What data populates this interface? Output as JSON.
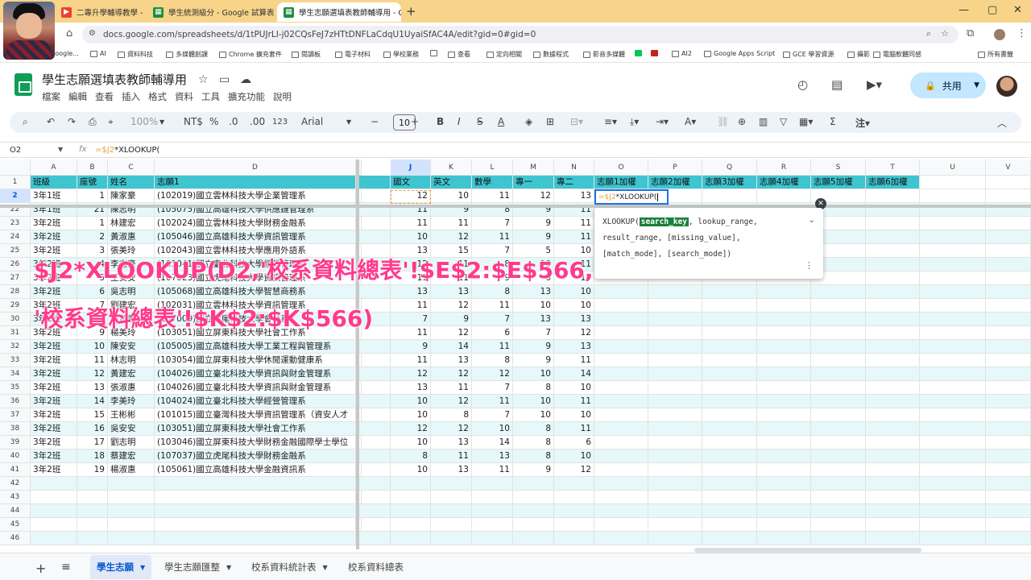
{
  "browser": {
    "tabs": [
      {
        "title": "二專升學輔導教學 - Goo",
        "icon": "youtube-icon"
      },
      {
        "title": "學生統測級分 - Google 試算表",
        "icon": "sheets-icon"
      },
      {
        "title": "學生志願選填表教師輔導用 - G",
        "icon": "sheets-icon",
        "active": true
      }
    ],
    "url": "docs.google.com/spreadsheets/d/1tPUJrLI-j02CQsFeJ7zHTtDNFLaCdqU1UyaiSfAC4A/edit?gid=0#gid=0",
    "bookmarks": [
      "Google...",
      "AI",
      "資料科技",
      "多媒體創課",
      "Chrome 擴充套件",
      "閱讀板",
      "電子材料",
      "學校業務",
      "",
      "查看",
      "定向相關",
      "數據程式",
      "影音多媒體",
      "",
      "",
      "AI2",
      "Google Apps Script",
      "GCE 學習資源",
      "攝影",
      "電腦軟體同感"
    ],
    "all_bookmarks": "所有書籤"
  },
  "doc": {
    "title": "學生志願選填表教師輔導用",
    "menu": [
      "檔案",
      "編輯",
      "查看",
      "插入",
      "格式",
      "資料",
      "工具",
      "擴充功能",
      "說明"
    ],
    "share_label": "共用"
  },
  "toolbar": {
    "zoom": "100%",
    "currency": "NT$",
    "percent": "%",
    "dec_less": ".0",
    "dec_more": ".00",
    "num_format": "123",
    "font": "Arial",
    "font_size": "10"
  },
  "formula_bar": {
    "name_box": "O2",
    "fx": "fx",
    "formula_ref": "=$J2",
    "formula_rest": "*XLOOKUP("
  },
  "grid": {
    "column_letters": [
      "A",
      "B",
      "C",
      "D",
      "J",
      "K",
      "L",
      "M",
      "N",
      "O",
      "P",
      "Q",
      "R",
      "S",
      "T",
      "U",
      "V"
    ],
    "headers": [
      "班級",
      "座號",
      "姓名",
      "志願1",
      "國文",
      "英文",
      "數學",
      "專一",
      "專二",
      "志願1加權",
      "志願2加權",
      "志願3加權",
      "志願4加權",
      "志願5加權",
      "志願6加權"
    ],
    "rows": [
      {
        "n": "2",
        "cls": "3年1班",
        "seat": "1",
        "name": "陳家豪",
        "choice": "(102019)國立雲林科技大學企業管理系",
        "scores": [
          "12",
          "10",
          "11",
          "12",
          "13"
        ]
      },
      {
        "n": "22",
        "cls": "3年1班",
        "seat": "21",
        "name": "陳志明",
        "choice": "(105075)國立高雄科技大學供應鏈管理系",
        "scores": [
          "11",
          "9",
          "8",
          "9",
          "11"
        ]
      },
      {
        "n": "23",
        "cls": "3年2班",
        "seat": "1",
        "name": "林建宏",
        "choice": "(102024)國立雲林科技大學財務金融系",
        "scores": [
          "11",
          "11",
          "7",
          "9",
          "11"
        ]
      },
      {
        "n": "24",
        "cls": "3年2班",
        "seat": "2",
        "name": "黃淑惠",
        "choice": "(105046)國立高雄科技大學資訊管理系",
        "scores": [
          "10",
          "12",
          "11",
          "9",
          "11"
        ]
      },
      {
        "n": "25",
        "cls": "3年2班",
        "seat": "3",
        "name": "張美玲",
        "choice": "(102043)國立雲林科技大學應用外語系",
        "scores": [
          "13",
          "15",
          "7",
          "5",
          "10"
        ]
      },
      {
        "n": "26",
        "cls": "3年2班",
        "seat": "4",
        "name": "李志豪",
        "choice": "(101041)國立臺北科技大學經營管理系",
        "scores": [
          "12",
          "11",
          "8",
          "10",
          "11"
        ]
      },
      {
        "n": "27",
        "cls": "3年2班",
        "seat": "5",
        "name": "王安安",
        "choice": "(107023)國立虎尾科技大學資訊管理系",
        "scores": [
          "11",
          "11",
          "9",
          "6",
          "13"
        ]
      },
      {
        "n": "28",
        "cls": "3年2班",
        "seat": "6",
        "name": "吳志明",
        "choice": "(105068)國立高雄科技大學智慧商務系",
        "scores": [
          "13",
          "13",
          "8",
          "13",
          "10"
        ]
      },
      {
        "n": "29",
        "cls": "3年2班",
        "seat": "7",
        "name": "劉建宏",
        "choice": "(102031)國立雲林科技大學資訊管理系",
        "scores": [
          "11",
          "12",
          "11",
          "10",
          "10"
        ]
      },
      {
        "n": "30",
        "cls": "3年2班",
        "seat": "8",
        "name": "蔡淑惠",
        "choice": "(107009)國立虎尾科技大學會計系",
        "scores": [
          "7",
          "9",
          "7",
          "13",
          "13"
        ]
      },
      {
        "n": "31",
        "cls": "3年2班",
        "seat": "9",
        "name": "楊美玲",
        "choice": "(103051)國立屏東科技大學社會工作系",
        "scores": [
          "11",
          "12",
          "6",
          "7",
          "12"
        ]
      },
      {
        "n": "32",
        "cls": "3年2班",
        "seat": "10",
        "name": "陳安安",
        "choice": "(105005)國立高雄科技大學工業工程與管理系",
        "scores": [
          "9",
          "14",
          "11",
          "9",
          "13"
        ]
      },
      {
        "n": "33",
        "cls": "3年2班",
        "seat": "11",
        "name": "林志明",
        "choice": "(103054)國立屏東科技大學休閒運動健康系",
        "scores": [
          "11",
          "13",
          "8",
          "9",
          "11"
        ]
      },
      {
        "n": "34",
        "cls": "3年2班",
        "seat": "12",
        "name": "黃建宏",
        "choice": "(104026)國立臺北科技大學資訊與財金管理系",
        "scores": [
          "12",
          "12",
          "12",
          "10",
          "14"
        ]
      },
      {
        "n": "35",
        "cls": "3年2班",
        "seat": "13",
        "name": "張淑惠",
        "choice": "(104026)國立臺北科技大學資訊與財金管理系",
        "scores": [
          "13",
          "11",
          "7",
          "8",
          "10"
        ]
      },
      {
        "n": "36",
        "cls": "3年2班",
        "seat": "14",
        "name": "李美玲",
        "choice": "(104024)國立臺北科技大學經營管理系",
        "scores": [
          "10",
          "12",
          "11",
          "10",
          "11"
        ]
      },
      {
        "n": "37",
        "cls": "3年2班",
        "seat": "15",
        "name": "王彬彬",
        "choice": "(101015)國立臺灣科技大學資訊管理系（資安人才",
        "scores": [
          "10",
          "8",
          "7",
          "10",
          "10"
        ]
      },
      {
        "n": "38",
        "cls": "3年2班",
        "seat": "16",
        "name": "吳安安",
        "choice": "(103051)國立屏東科技大學社會工作系",
        "scores": [
          "12",
          "12",
          "10",
          "8",
          "11"
        ]
      },
      {
        "n": "39",
        "cls": "3年2班",
        "seat": "17",
        "name": "劉志明",
        "choice": "(103046)國立屏東科技大學財務金融國際學士學位",
        "scores": [
          "10",
          "13",
          "14",
          "8",
          "6"
        ]
      },
      {
        "n": "40",
        "cls": "3年2班",
        "seat": "18",
        "name": "蔡建宏",
        "choice": "(107037)國立虎尾科技大學財務金融系",
        "scores": [
          "8",
          "11",
          "13",
          "8",
          "10"
        ]
      },
      {
        "n": "41",
        "cls": "3年2班",
        "seat": "19",
        "name": "楊淑惠",
        "choice": "(105061)國立高雄科技大學金融資訊系",
        "scores": [
          "10",
          "13",
          "11",
          "9",
          "12"
        ]
      },
      {
        "n": "42"
      },
      {
        "n": "43"
      },
      {
        "n": "44"
      },
      {
        "n": "45"
      },
      {
        "n": "46"
      }
    ],
    "editing_cell": {
      "ref": "=$J2",
      "rest": "*XLOOKUP("
    }
  },
  "autocomplete": {
    "fn": "XLOOKUP(",
    "active_arg": "search_key",
    "line1_rest": ", lookup_range,",
    "line2": "result_range, [missing_value],",
    "line3": "[match_mode], [search_mode])"
  },
  "overlay": {
    "line1": "$J2*XLOOKUP(D2,'校系資料總表'!$E$2:$E$566,",
    "line2": "'校系資料總表'!$K$2:$K$566)"
  },
  "sheets": [
    {
      "label": "學生志願",
      "active": true
    },
    {
      "label": "學生志願匯整"
    },
    {
      "label": "校系資料統計表"
    },
    {
      "label": "校系資料總表"
    }
  ],
  "colors": {
    "header_fill": "#3ec5d0",
    "band_fill": "#e6f8f9",
    "caption": "#ff3a8c",
    "selection": "#1a73e8"
  }
}
